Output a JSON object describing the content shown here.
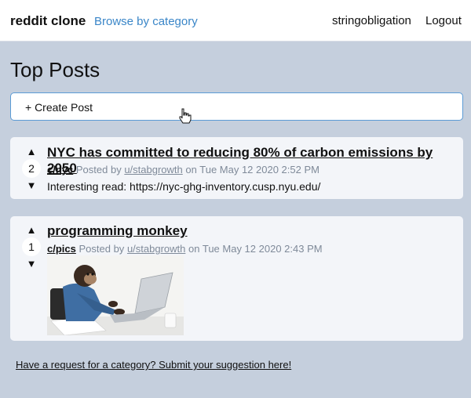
{
  "navbar": {
    "brand": "reddit clone",
    "browse_label": "Browse by category",
    "username": "stringobligation",
    "logout_label": "Logout"
  },
  "page": {
    "title": "Top Posts",
    "create_post_label": "+ Create Post"
  },
  "posts": [
    {
      "votes": "2",
      "title": "NYC has committed to reducing 80% of carbon emissions by 2050",
      "category": "c/nyc",
      "posted_by_prefix": "Posted by",
      "author": "u/stabgrowth",
      "date_prefix": "on",
      "date": "Tue May 12 2020 2:52 PM",
      "body": "Interesting read: https://nyc-ghg-inventory.cusp.nyu.edu/"
    },
    {
      "votes": "1",
      "title": "programming monkey",
      "category": "c/pics",
      "posted_by_prefix": "Posted by",
      "author": "u/stabgrowth",
      "date_prefix": "on",
      "date": "Tue May 12 2020 2:43 PM",
      "image_icon": "monkey-at-laptop-photo"
    }
  ],
  "footer": {
    "suggestion_link": "Have a request for a category? Submit your suggestion here!"
  },
  "colors": {
    "background": "#c5cfdd",
    "card": "#f3f5f9",
    "link_accent": "#3a86c8",
    "input_border": "#5b9bd5"
  },
  "icons": {
    "upvote": "triangle-up",
    "downvote": "triangle-down",
    "cursor": "hand-pointer"
  }
}
